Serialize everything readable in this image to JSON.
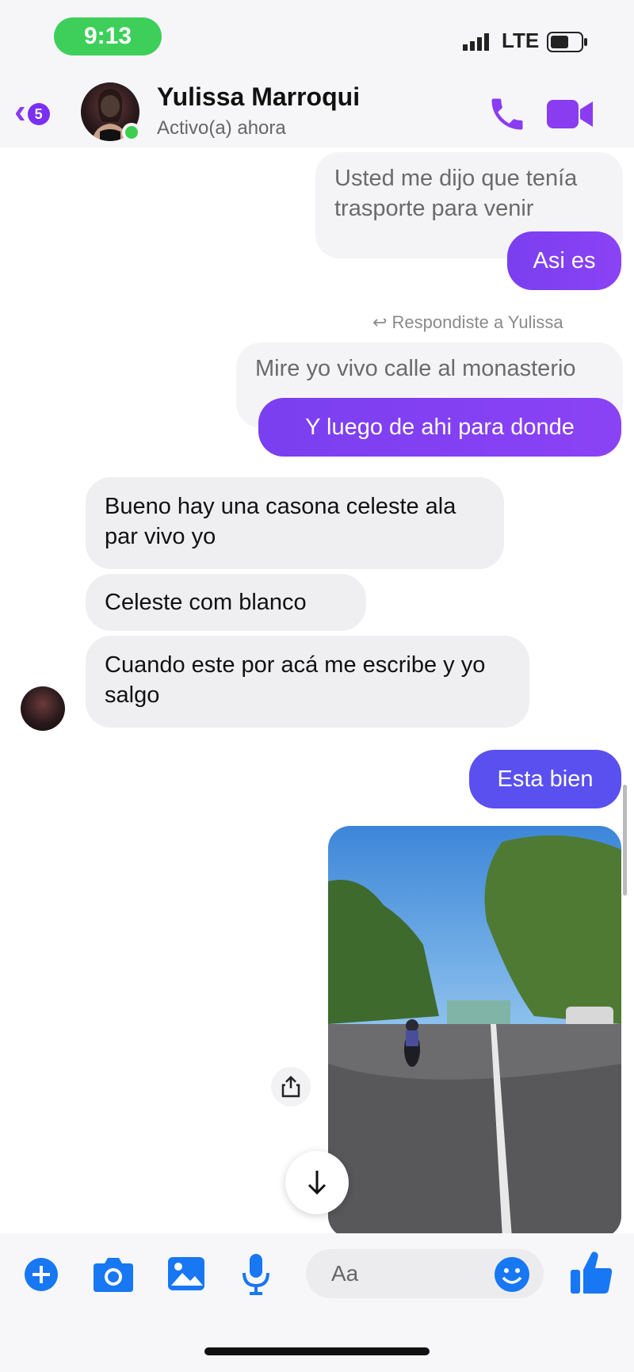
{
  "status_bar": {
    "time": "9:13",
    "network": "LTE"
  },
  "header": {
    "unread_count": "5",
    "contact_name": "Yulissa Marroqui",
    "contact_status": "Activo(a) ahora"
  },
  "messages": [
    {
      "text": "Usted me dijo que tenía trasporte para venir",
      "side": "quoted"
    },
    {
      "text": "Asi es",
      "side": "out"
    },
    {
      "text": "Mire yo vivo calle al monasterio",
      "side": "quoted"
    },
    {
      "text": "Y luego de ahi para donde",
      "side": "out"
    },
    {
      "text": "Bueno hay una casona celeste ala par vivo yo",
      "side": "in"
    },
    {
      "text": "Celeste com blanco",
      "side": "in"
    },
    {
      "text": "Cuando este por acá me escribe y yo salgo",
      "side": "in"
    },
    {
      "text": "Esta bien",
      "side": "out"
    }
  ],
  "reply_note": "Respondiste a Yulissa",
  "composer": {
    "placeholder": "Aa"
  },
  "colors": {
    "accent_purple": "#8b42f5",
    "accent_blue": "#1877f2",
    "online_green": "#3ccf4e"
  },
  "icons": [
    "back-chevron-icon",
    "phone-icon",
    "video-camera-icon",
    "plus-icon",
    "camera-icon",
    "gallery-icon",
    "microphone-icon",
    "emoji-icon",
    "thumbs-up-icon",
    "share-icon",
    "arrow-down-icon"
  ]
}
